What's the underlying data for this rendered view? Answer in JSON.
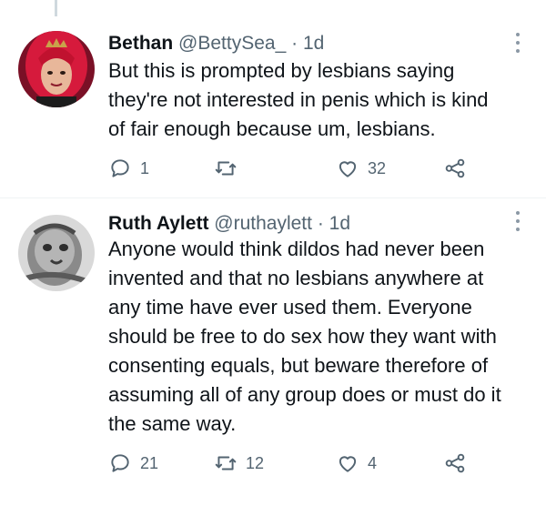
{
  "tweets": [
    {
      "name": "Bethan",
      "handle": "@BettySea_",
      "separator": "·",
      "time": "1d",
      "text": "But this is prompted by lesbians saying\nthey're not interested in penis which is kind\nof fair enough because um, lesbians.",
      "replies": "1",
      "retweets": "",
      "likes": "32"
    },
    {
      "name": "Ruth Aylett",
      "handle": "@ruthaylett",
      "separator": "·",
      "time": "1d",
      "text": "Anyone would think dildos had never been\ninvented and that no lesbians anywhere at\nany time have ever used them. Everyone\nshould be free to do sex how they want with\nconsenting equals, but beware therefore of\nassuming all of any group does or must do it\nthe same way.",
      "replies": "21",
      "retweets": "12",
      "likes": "4"
    }
  ],
  "icons": {
    "reply": "reply-icon",
    "retweet": "retweet-icon",
    "like": "like-icon",
    "share": "share-icon",
    "more": "more-icon"
  },
  "colors": {
    "text": "#0f1419",
    "secondary": "#536471",
    "thread_line": "#cfd9de"
  }
}
